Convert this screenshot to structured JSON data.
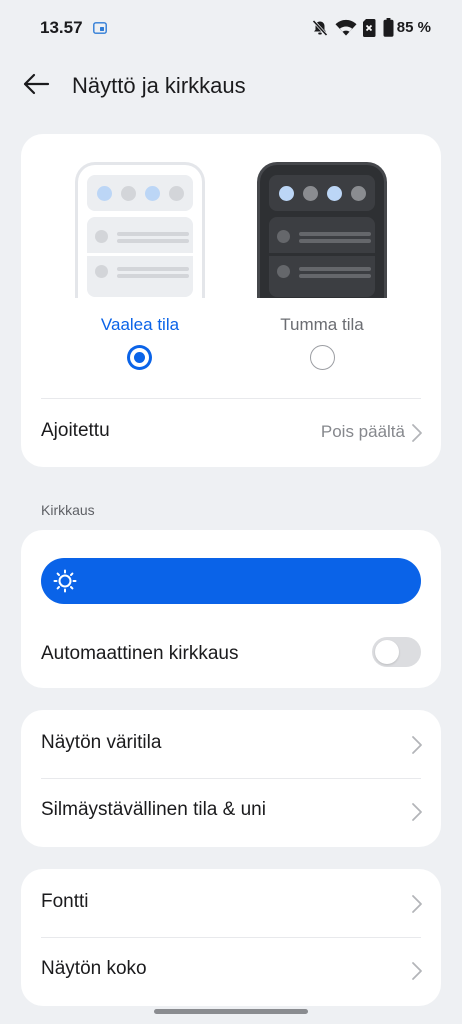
{
  "status_bar": {
    "time": "13.57",
    "battery_percent": "85 %",
    "icons": [
      "cast-icon",
      "bell-off-icon",
      "wifi-icon",
      "sim-card-icon",
      "battery-icon"
    ]
  },
  "header": {
    "back_icon": "arrow-left-icon",
    "title": "Näyttö ja kirkkaus"
  },
  "theme": {
    "light_label": "Vaalea tila",
    "dark_label": "Tumma tila",
    "selected": "light",
    "scheduled_label": "Ajoitettu",
    "scheduled_value": "Pois päältä"
  },
  "brightness": {
    "section_label": "Kirkkaus",
    "level": 1.0,
    "auto_label": "Automaattinen kirkkaus",
    "auto_enabled": false
  },
  "color_section": {
    "items": [
      {
        "label": "Näytön väritila"
      },
      {
        "label": "Silmäystävällinen tila & uni"
      }
    ]
  },
  "font_section": {
    "items": [
      {
        "label": "Fontti"
      },
      {
        "label": "Näytön koko"
      }
    ]
  },
  "colors": {
    "accent": "#0a63e8",
    "background": "#eef0f3",
    "card": "#ffffff"
  }
}
